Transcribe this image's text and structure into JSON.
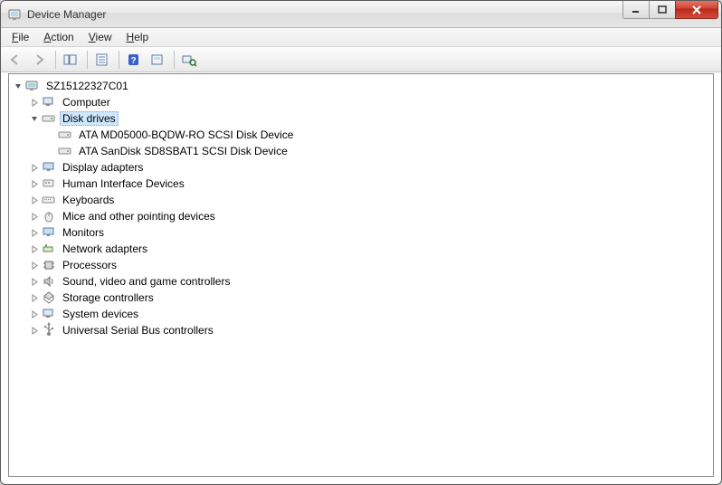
{
  "window": {
    "title": "Device Manager"
  },
  "menu": {
    "file": "File",
    "action": "Action",
    "view": "View",
    "help": "Help"
  },
  "tree": {
    "root": "SZ15122327C01",
    "computer": "Computer",
    "disk_drives": "Disk drives",
    "disk1": "ATA MD05000-BQDW-RO SCSI Disk Device",
    "disk2": "ATA SanDisk SD8SBAT1 SCSI Disk Device",
    "display_adapters": "Display adapters",
    "hid": "Human Interface Devices",
    "keyboards": "Keyboards",
    "mice": "Mice and other pointing devices",
    "monitors": "Monitors",
    "network": "Network adapters",
    "processors": "Processors",
    "sound": "Sound, video and game controllers",
    "storage": "Storage controllers",
    "system": "System devices",
    "usb": "Universal Serial Bus controllers"
  }
}
